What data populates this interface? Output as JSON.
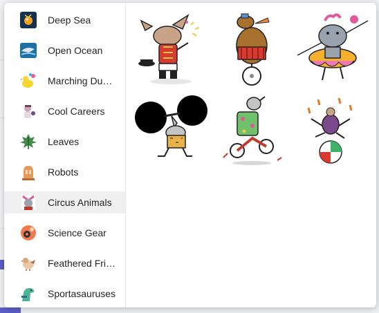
{
  "categories": [
    {
      "label": "Deep Sea",
      "icon": "deep-sea-thumbnail"
    },
    {
      "label": "Open Ocean",
      "icon": "open-ocean-thumbnail"
    },
    {
      "label": "Marching Ducks",
      "icon": "marching-ducks-thumbnail"
    },
    {
      "label": "Cool Careers",
      "icon": "cool-careers-thumbnail"
    },
    {
      "label": "Leaves",
      "icon": "leaves-thumbnail"
    },
    {
      "label": "Robots",
      "icon": "robots-thumbnail"
    },
    {
      "label": "Circus Animals",
      "icon": "circus-animals-thumbnail"
    },
    {
      "label": "Science Gear",
      "icon": "science-gear-thumbnail"
    },
    {
      "label": "Feathered Frie...",
      "icon": "feathered-friends-thumbnail"
    },
    {
      "label": "Sportasauruses",
      "icon": "sportasauruses-thumbnail"
    }
  ],
  "selected_category": "Circus Animals",
  "stickers": [
    {
      "name": "ringmaster-rabbit-sticker"
    },
    {
      "name": "unicycle-bear-sticker"
    },
    {
      "name": "tightrope-hippo-sticker"
    },
    {
      "name": "strongman-rhino-sticker"
    },
    {
      "name": "motorbike-rhino-sticker"
    },
    {
      "name": "juggling-ball-sticker"
    }
  ],
  "colors": {
    "accent": "#5b5fc7",
    "selected_bg": "#f0f0f0"
  }
}
